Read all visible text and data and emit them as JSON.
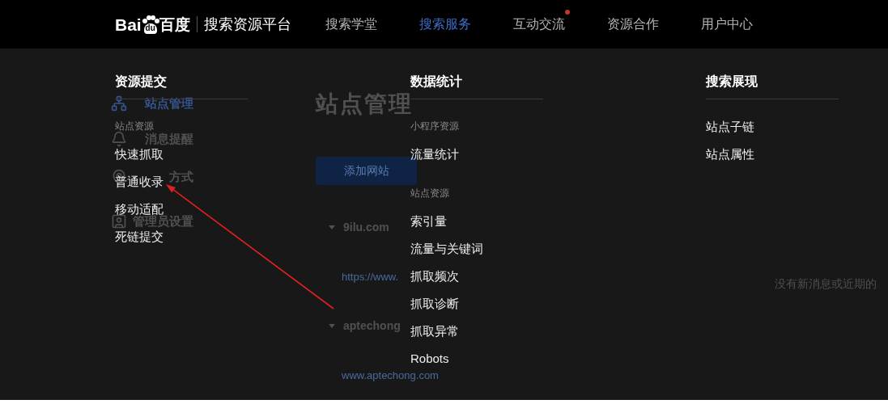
{
  "header": {
    "logo": {
      "text_left": "Bai",
      "paw_text": "du",
      "text_right": "百度"
    },
    "platform_name": "搜索资源平台",
    "nav": [
      {
        "label": "搜索学堂",
        "selected": false,
        "dot": false
      },
      {
        "label": "搜索服务",
        "selected": true,
        "dot": false
      },
      {
        "label": "互动交流",
        "selected": false,
        "dot": true
      },
      {
        "label": "资源合作",
        "selected": false,
        "dot": false
      },
      {
        "label": "用户中心",
        "selected": false,
        "dot": false
      }
    ]
  },
  "background_page": {
    "sidebar": [
      {
        "label": "站点管理",
        "selected": true
      },
      {
        "label": "消息提醒",
        "selected": false
      },
      {
        "label": "方式",
        "selected": false
      },
      {
        "label": "管理员设置",
        "selected": false
      }
    ],
    "title": "站点管理",
    "add_button": "添加网站",
    "sites": [
      {
        "name": "9ilu.com",
        "url": "https://www."
      },
      {
        "name": "aptechong",
        "url": "www.aptechong.com"
      }
    ],
    "notice": "没有新消息或近期的"
  },
  "dropdown": {
    "columns": [
      {
        "title": "资源提交",
        "groups": [
          {
            "label": "站点资源",
            "items": [
              "快速抓取",
              "普通收录",
              "移动适配",
              "死链提交"
            ]
          }
        ]
      },
      {
        "title": "数据统计",
        "groups": [
          {
            "label": "小程序资源",
            "items": [
              "流量统计"
            ]
          },
          {
            "label": "站点资源",
            "items": [
              "索引量",
              "流量与关键词",
              "抓取频次",
              "抓取诊断",
              "抓取异常",
              "Robots"
            ]
          }
        ]
      },
      {
        "title": "搜索展现",
        "groups": [
          {
            "items": [
              "站点子链",
              "站点属性"
            ]
          }
        ]
      }
    ]
  }
}
